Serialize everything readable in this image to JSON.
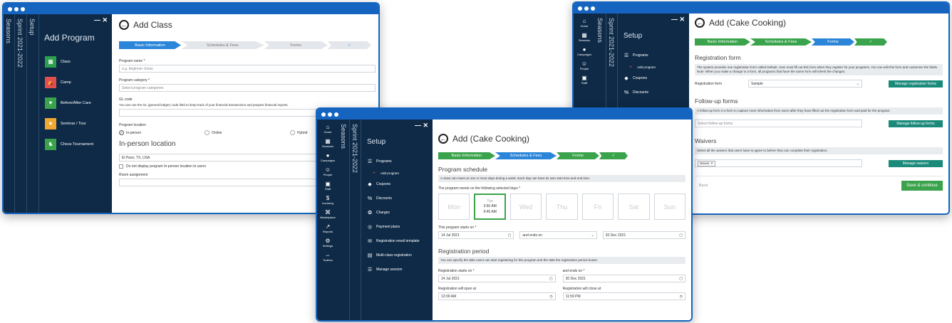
{
  "win1": {
    "vertical_tabs": [
      "Seasons",
      "Sprint 2021-2022",
      "Setup"
    ],
    "panel_title": "Add Program",
    "programs": [
      {
        "label": "Class",
        "icon": "calendar-icon",
        "color": "#2e9e4f"
      },
      {
        "label": "Camp",
        "icon": "camp-icon",
        "color": "#e04e4e"
      },
      {
        "label": "Before/After Care",
        "icon": "care-icon",
        "color": "#3aa34c"
      },
      {
        "label": "Seminar / Tour",
        "icon": "seminar-icon",
        "color": "#f0a830"
      },
      {
        "label": "Chess Tournament",
        "icon": "chess-icon",
        "color": "#3aa34c"
      }
    ],
    "title": "Add Class",
    "steps": [
      "Basic Information",
      "Schedules & Fees",
      "Forms",
      "✓"
    ],
    "program_name_label": "Program name *",
    "program_name_placeholder": "e.g. beginner chess",
    "program_category_label": "Program category *",
    "program_category_placeholder": "Select program categories",
    "gl_code_label": "GL code",
    "gl_code_note": "You can use the GL (general ledger) code field to keep track of your financial transactions and prepare financial reports.",
    "program_location_label": "Program location",
    "location_options": [
      "In-person",
      "Online",
      "Hybrid"
    ],
    "inperson_title": "In-person location",
    "location_value": "El Paso, TX, USA",
    "hide_location_label": "Do not display program In-person location to users",
    "room_label": "Room assignment"
  },
  "nav_icons": [
    "Home",
    "Sessions",
    "Campaigns",
    "People",
    "Staff",
    "Invoicing",
    "Marketplace",
    "Reports",
    "Settings",
    "Toolbox"
  ],
  "win2": {
    "vertical_tabs": [
      "Seasons",
      "Sprint 2021-2022"
    ],
    "setup_title": "Setup",
    "nav": [
      "Programs",
      "Add program",
      "Coupons",
      "Discounts",
      "Charges",
      "Payment plans",
      "Registration email template",
      "Multi-class registration",
      "Manage session"
    ],
    "title": "Add (Cake Cooking)",
    "steps": [
      "Basic Information",
      "Schedules & Fees",
      "Forms",
      "✓"
    ],
    "schedule_title": "Program schedule",
    "schedule_note": "A class can meet on one or more days during a week. Each day can have its own start time and end time.",
    "days_label": "The program meets on the following selected days *",
    "days": [
      "Mon",
      "Tue",
      "Wed",
      "Thu",
      "Fri",
      "Sat",
      "Sun"
    ],
    "tue_start": "3:50 AM",
    "tue_end": "9:45 AM",
    "starts_label": "This program starts on *",
    "start_date": "14 Jul 2021",
    "ends_select": "and ends on",
    "end_date": "20 Dec 2021",
    "reg_title": "Registration period",
    "reg_note": "You can specify the date users can start registering for this program and the date the registration period closes.",
    "reg_starts_label": "Registration starts on *",
    "reg_start": "14 Jul 2021",
    "reg_ends_label": "and ends on *",
    "reg_end": "30 Dec 2021",
    "reg_open_label": "Registration will open at",
    "reg_open": "12:00 AM",
    "reg_close_label": "Registration will close at",
    "reg_close": "11:59 PM"
  },
  "win3": {
    "vertical_tabs": [
      "Seasons",
      "Sprint 2021-2022"
    ],
    "setup_title": "Setup",
    "nav": [
      "Programs",
      "Add program",
      "Coupons",
      "Discounts"
    ],
    "title": "Add (Cake Cooking)",
    "steps": [
      "Basic Information",
      "Schedules & Fees",
      "Forms",
      "✓"
    ],
    "reg_form_title": "Registration form",
    "reg_form_note": "The system provides one registration form called Default. User must fill out this form when they register for your programs. You can edit this form and customize the fields. Note: When you make a change to a form, all programs that have the same form will inherit the changes.",
    "reg_form_label": "Registration form",
    "reg_form_value": "Sample",
    "manage_reg_forms": "Manage registration forms",
    "followup_title": "Follow-up forms",
    "followup_note": "A follow-up form is a form to capture more information from users after they have filled out the registration form and paid for the program.",
    "followup_placeholder": "Select follow-up forms",
    "manage_followup": "Manage follow-up forms",
    "waivers_title": "Waivers",
    "waivers_note": "Select all the waivers that users have to agree to before they can complete their registration.",
    "waiver_tag": "Waiver",
    "manage_waivers": "Manage waivers",
    "back": "Back",
    "save": "Save & continue"
  }
}
